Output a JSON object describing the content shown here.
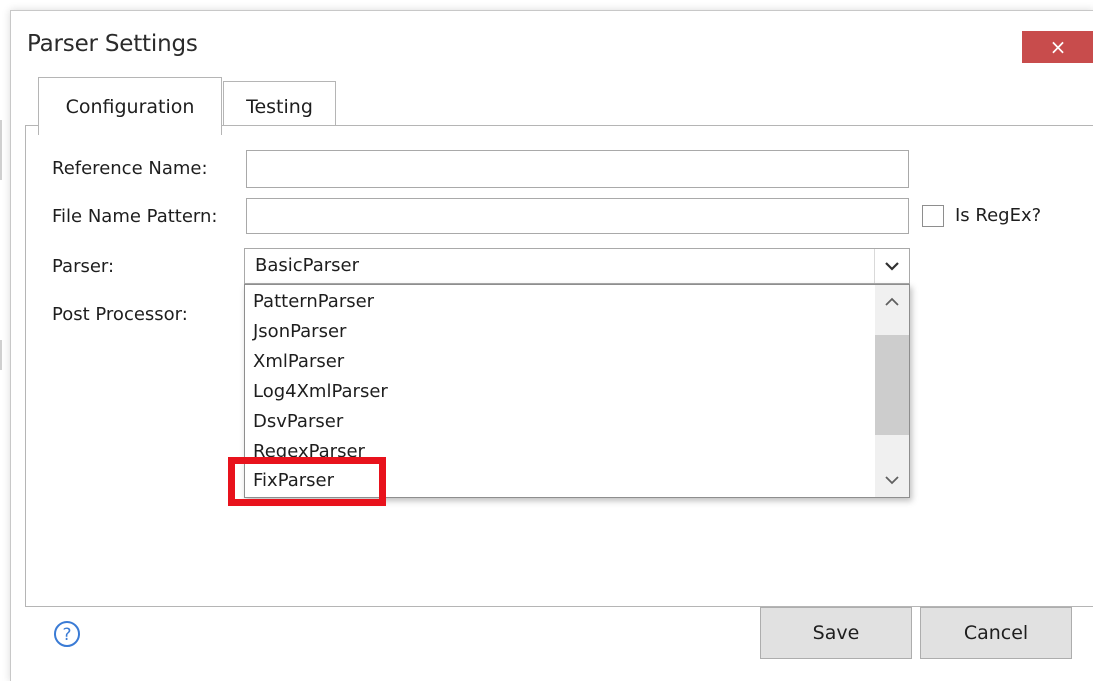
{
  "dialog": {
    "title": "Parser Settings",
    "close_glyph": "×",
    "tabs": [
      {
        "label": "Configuration",
        "active": true
      },
      {
        "label": "Testing",
        "active": false
      }
    ]
  },
  "form": {
    "reference_name_label": "Reference Name:",
    "reference_name_value": "",
    "file_name_pattern_label": "File Name Pattern:",
    "file_name_pattern_value": "",
    "is_regex_label": "Is RegEx?",
    "is_regex_checked": false,
    "parser_label": "Parser:",
    "parser_value": "BasicParser",
    "post_processor_label": "Post Processor:"
  },
  "dropdown": {
    "items": [
      "PatternParser",
      "JsonParser",
      "XmlParser",
      "Log4XmlParser",
      "DsvParser",
      "RegexParser",
      "FixParser"
    ],
    "highlighted_item": "FixParser"
  },
  "footer": {
    "help_icon": "question-circle-icon",
    "save_label": "Save",
    "cancel_label": "Cancel"
  },
  "colors": {
    "close_button_bg": "#c84c4c",
    "highlight_box": "#e8121c",
    "help_icon": "#3a7bd5"
  }
}
